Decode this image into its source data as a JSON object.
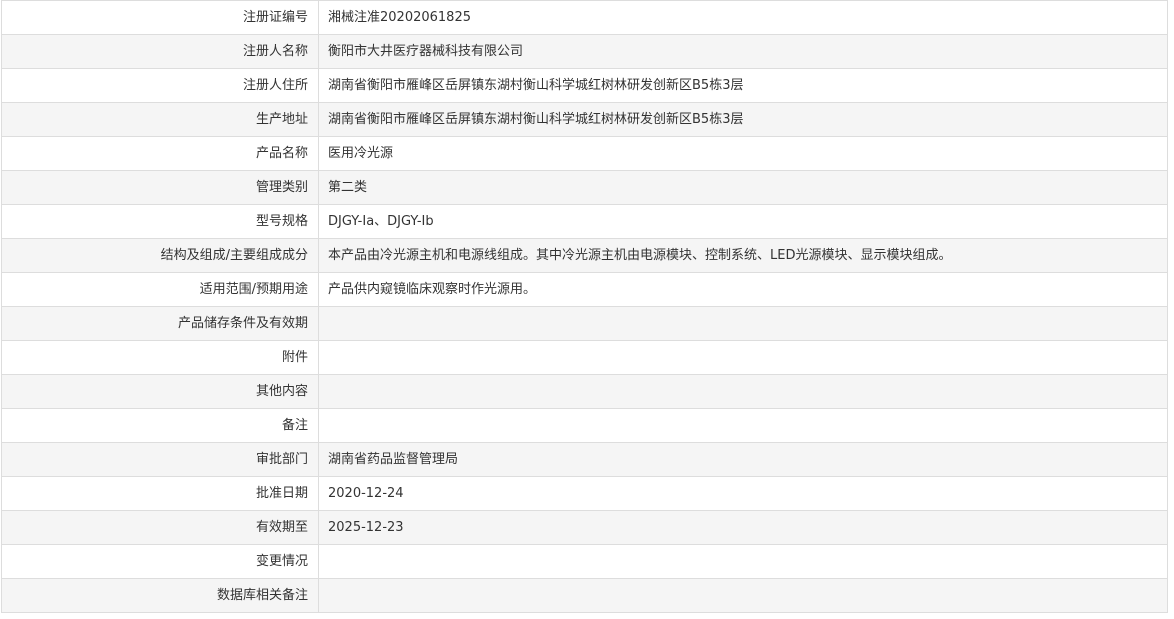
{
  "record": {
    "rows": [
      {
        "label": "注册证编号",
        "value": "湘械注准20202061825"
      },
      {
        "label": "注册人名称",
        "value": "衡阳市大井医疗器械科技有限公司"
      },
      {
        "label": "注册人住所",
        "value": "湖南省衡阳市雁峰区岳屏镇东湖村衡山科学城红树林研发创新区B5栋3层"
      },
      {
        "label": "生产地址",
        "value": "湖南省衡阳市雁峰区岳屏镇东湖村衡山科学城红树林研发创新区B5栋3层"
      },
      {
        "label": "产品名称",
        "value": "医用冷光源"
      },
      {
        "label": "管理类别",
        "value": "第二类"
      },
      {
        "label": "型号规格",
        "value": "DJGY-Ia、DJGY-Ib"
      },
      {
        "label": "结构及组成/主要组成成分",
        "value": "本产品由冷光源主机和电源线组成。其中冷光源主机由电源模块、控制系统、LED光源模块、显示模块组成。"
      },
      {
        "label": "适用范围/预期用途",
        "value": "产品供内窥镜临床观察时作光源用。"
      },
      {
        "label": "产品储存条件及有效期",
        "value": ""
      },
      {
        "label": "附件",
        "value": ""
      },
      {
        "label": "其他内容",
        "value": ""
      },
      {
        "label": "备注",
        "value": ""
      },
      {
        "label": "审批部门",
        "value": "湖南省药品监督管理局"
      },
      {
        "label": "批准日期",
        "value": "2020-12-24"
      },
      {
        "label": "有效期至",
        "value": "2025-12-23"
      },
      {
        "label": "变更情况",
        "value": ""
      },
      {
        "label": "数据库相关备注",
        "value": ""
      }
    ]
  }
}
